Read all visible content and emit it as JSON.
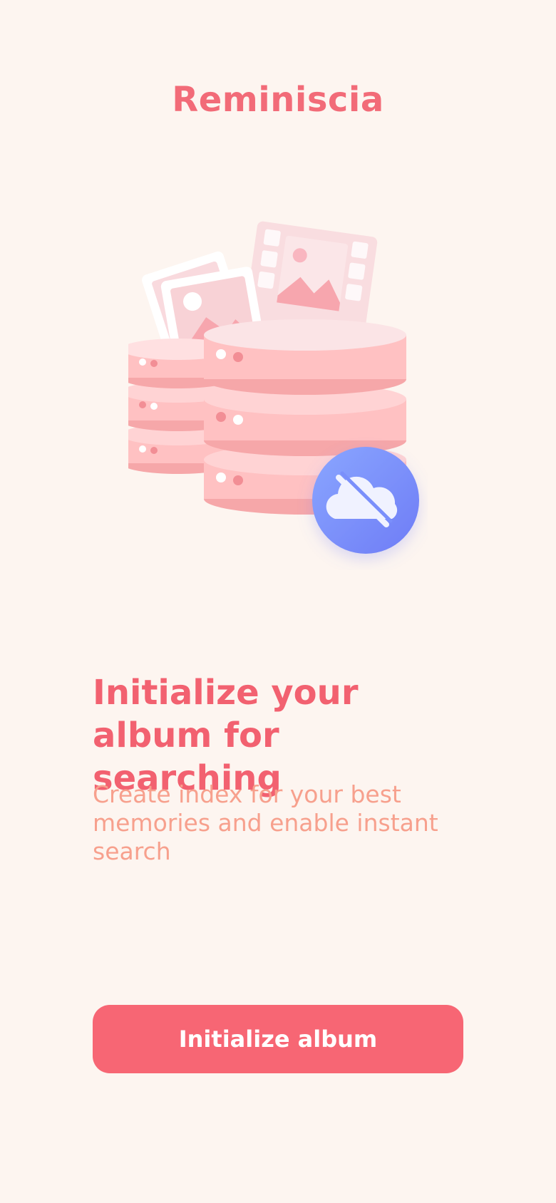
{
  "app": {
    "title": "Reminiscia"
  },
  "illustration": {
    "icon": "database-photos-offline-illustration",
    "badge_icon": "cloud-off-icon"
  },
  "onboarding": {
    "headline": "Initialize your album for searching",
    "description": "Create index for your best memories and enable instant search"
  },
  "actions": {
    "primary_label": "Initialize album"
  },
  "colors": {
    "background": "#FDF5F0",
    "accent": "#F76674",
    "headline": "#F26170",
    "subtext": "#F7A08D",
    "badge": "#7A8FFB"
  }
}
